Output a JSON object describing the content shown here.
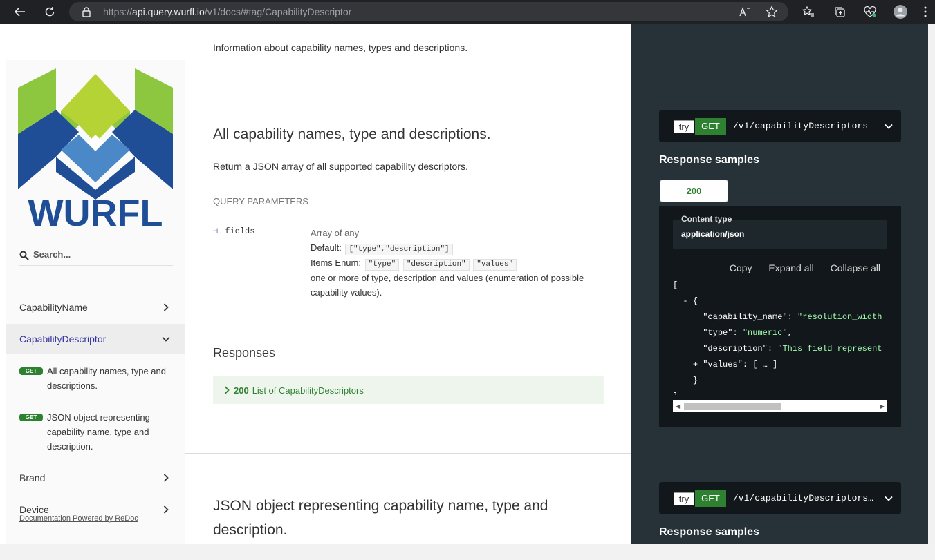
{
  "browser": {
    "url_prefix": "https://",
    "url_host": "api.query.wurfl.io",
    "url_path": "/v1/docs/#tag/CapabilityDescriptor"
  },
  "sidebar": {
    "search_placeholder": "Search...",
    "logo_text": "WURFL",
    "items": [
      {
        "label": "CapabilityName"
      },
      {
        "label": "CapabilityDescriptor"
      },
      {
        "label": "Brand"
      },
      {
        "label": "Device"
      }
    ],
    "sub_items": [
      {
        "method": "GET",
        "label": "All capability names, type and descriptions."
      },
      {
        "method": "GET",
        "label": "JSON object representing capability name, type and description."
      }
    ],
    "powered_by": "Documentation Powered by ReDoc"
  },
  "main": {
    "intro": "Information about capability names, types and descriptions.",
    "op1": {
      "title": "All capability names, type and descriptions.",
      "description": "Return a JSON array of all supported capability descriptors.",
      "query_params_label": "QUERY PARAMETERS",
      "param": {
        "name": "fields",
        "type": "Array of any",
        "default_label": "Default:",
        "default_value": "[\"type\",\"description\"]",
        "enum_label": "Items Enum:",
        "enum_values": [
          "\"type\"",
          "\"description\"",
          "\"values\""
        ],
        "description": "one or more of type, description and values (enumeration of possible capability values)."
      },
      "responses_title": "Responses",
      "response": {
        "code": "200",
        "label": "List of CapabilityDescriptors"
      }
    },
    "op2": {
      "title": "JSON object representing capability name, type and description."
    }
  },
  "right": {
    "ep1": {
      "try": "try",
      "method": "GET",
      "path": "/v1/capabilityDescriptors"
    },
    "response_samples": "Response samples",
    "tab": "200",
    "content_type_label": "Content type",
    "content_type_value": "application/json",
    "actions": {
      "copy": "Copy",
      "expand": "Expand all",
      "collapse": "Collapse all"
    },
    "code": {
      "open_bracket": "[",
      "toggle_minus": "-",
      "open_brace": "{",
      "k1": "\"capability_name\"",
      "v1": "\"resolution_width",
      "k2": "\"type\"",
      "v2": "\"numeric\"",
      "k3": "\"description\"",
      "v3": "\"This field represent",
      "toggle_plus": "+",
      "k4": "\"values\"",
      "v4": "[ … ]",
      "close_brace": "}",
      "close_bracket": "]"
    },
    "ep2": {
      "try": "try",
      "method": "GET",
      "path": "/v1/capabilityDescriptors/…"
    },
    "response_samples2": "Response samples"
  },
  "colors": {
    "get_green": "#2f8132",
    "active_link": "#32329f",
    "dark_panel": "#263238",
    "code_bg": "#11171a",
    "code_string": "#a0fbaa",
    "logo_green": "#8dc63f",
    "logo_blue": "#1f4e96",
    "logo_lightblue": "#4a88c8"
  }
}
